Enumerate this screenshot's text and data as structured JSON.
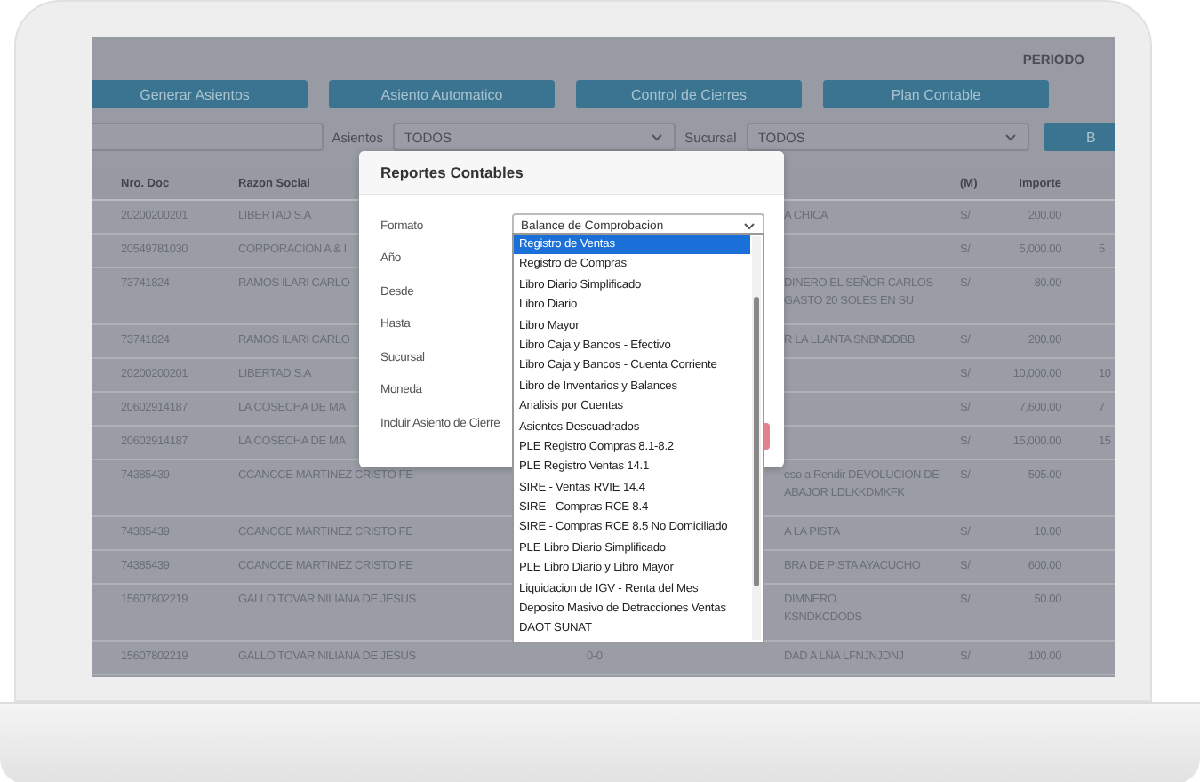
{
  "header": {
    "period_label": "PERIODO"
  },
  "toolbar_buttons": [
    "Generar Asientos",
    "Asiento Automatico",
    "Control de Cierres",
    "Plan Contable"
  ],
  "filters": {
    "asientos_label": "Asientos",
    "asientos_value": "TODOS",
    "sucursal_label": "Sucursal",
    "sucursal_value": "TODOS",
    "search_button": "B"
  },
  "table": {
    "columns": {
      "nro_doc": "Nro. Doc",
      "razon_social": "Razon Social",
      "moneda": "(M)",
      "importe": "Importe"
    },
    "rows": [
      {
        "nro_doc": "20200200201",
        "razon_social": "LIBERTAD S.A",
        "glosa": [
          "A CHICA"
        ],
        "moneda": "S/",
        "importe": "200.00"
      },
      {
        "nro_doc": "20549781030",
        "razon_social": "CORPORACION A & I",
        "glosa": [],
        "moneda": "S/",
        "importe": "5,000.00",
        "column_8": "5"
      },
      {
        "nro_doc": "73741824",
        "razon_social": "RAMOS ILARI CARLO",
        "glosa": [
          "DINERO EL SEÑOR CARLOS",
          "GASTO 20 SOLES EN SU"
        ],
        "moneda": "S/",
        "importe": "80.00"
      },
      {
        "nro_doc": "73741824",
        "razon_social": "RAMOS ILARI CARLO",
        "glosa": [
          "R LA LLANTA SNBNDDBB"
        ],
        "moneda": "S/",
        "importe": "200.00"
      },
      {
        "nro_doc": "20200200201",
        "razon_social": "LIBERTAD S.A",
        "glosa": [],
        "moneda": "S/",
        "importe": "10,000.00",
        "column_8": "10"
      },
      {
        "nro_doc": "20602914187",
        "razon_social": "LA COSECHA DE MA",
        "glosa": [],
        "moneda": "S/",
        "importe": "7,600.00",
        "column_8": "7"
      },
      {
        "nro_doc": "20602914187",
        "razon_social": "LA COSECHA DE MA",
        "glosa": [],
        "moneda": "S/",
        "importe": "15,000.00",
        "column_8": "15"
      },
      {
        "nro_doc": "74385439",
        "razon_social": "CCANCCE MARTINEZ CRISTO FE",
        "glosa": [
          "eso a Rendir DEVOLUCION DE",
          "ABAJOR LDLKKDMKFK"
        ],
        "moneda": "S/",
        "importe": "505.00"
      },
      {
        "nro_doc": "74385439",
        "razon_social": "CCANCCE MARTINEZ CRISTO FE",
        "glosa": [
          "A LA PISTA"
        ],
        "moneda": "S/",
        "importe": "10.00"
      },
      {
        "nro_doc": "74385439",
        "razon_social": "CCANCCE MARTINEZ CRISTO FE",
        "glosa": [
          "BRA DE PISTA AYACUCHO"
        ],
        "moneda": "S/",
        "importe": "600.00"
      },
      {
        "nro_doc": "15607802219",
        "razon_social": "GALLO TOVAR NILIANA DE JESUS",
        "glosa": [
          "DIMNERO",
          "KSNDKCDODS"
        ],
        "moneda": "S/",
        "importe": "50.00"
      },
      {
        "nro_doc": "15607802219",
        "razon_social": "GALLO TOVAR NILIANA DE JESUS",
        "column_3": "0-0",
        "glosa": [
          "DAD A LÑA LFNJNJDNJ"
        ],
        "moneda": "S/",
        "importe": "100.00"
      }
    ]
  },
  "modal": {
    "title": "Reportes Contables",
    "fields": [
      {
        "label": "Formato",
        "value": "Balance de Comprobacion"
      },
      {
        "label": "Año"
      },
      {
        "label": "Desde"
      },
      {
        "label": "Hasta"
      },
      {
        "label": "Sucursal"
      },
      {
        "label": "Moneda"
      },
      {
        "label": "Incluir Asiento de Cierre"
      }
    ],
    "options": [
      {
        "label": "Registro de Ventas",
        "selected": true
      },
      {
        "label": "Registro de Compras",
        "selected": false
      },
      {
        "label": "Libro Diario Simplificado",
        "selected": false
      },
      {
        "label": "Libro Diario",
        "selected": false
      },
      {
        "label": "Libro Mayor",
        "selected": false
      },
      {
        "label": "Libro Caja y Bancos - Efectivo",
        "selected": false
      },
      {
        "label": "Libro Caja y Bancos - Cuenta Corriente",
        "selected": false
      },
      {
        "label": "Libro de Inventarios y Balances",
        "selected": false
      },
      {
        "label": "Analisis por Cuentas",
        "selected": false
      },
      {
        "label": "Asientos Descuadrados",
        "selected": false
      },
      {
        "label": "PLE Registro Compras 8.1-8.2",
        "selected": false
      },
      {
        "label": "PLE Registro Ventas 14.1",
        "selected": false
      },
      {
        "label": "SIRE - Ventas RVIE 14.4",
        "selected": false
      },
      {
        "label": "SIRE - Compras RCE 8.4",
        "selected": false
      },
      {
        "label": "SIRE - Compras RCE 8.5 No Domiciliado",
        "selected": false
      },
      {
        "label": "PLE Libro Diario Simplificado",
        "selected": false
      },
      {
        "label": "PLE Libro Diario y Libro Mayor",
        "selected": false
      },
      {
        "label": "Liquidacion de IGV - Renta del Mes",
        "selected": false
      },
      {
        "label": "Deposito Masivo de Detracciones Ventas",
        "selected": false
      },
      {
        "label": "DAOT SUNAT",
        "selected": false
      }
    ]
  }
}
